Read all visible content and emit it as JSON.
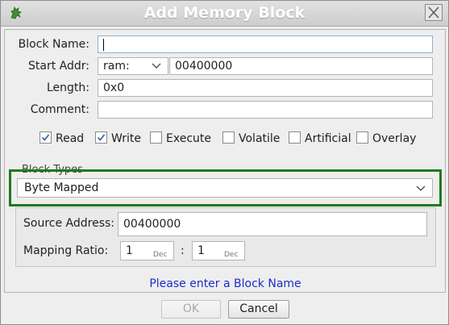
{
  "window": {
    "title": "Add Memory Block",
    "app_icon": "dragon-icon",
    "close_icon": "close-icon"
  },
  "form": {
    "block_name_label": "Block Name:",
    "block_name_value": "",
    "start_addr_label": "Start Addr:",
    "address_space": "ram:",
    "start_addr_value": "00400000",
    "length_label": "Length:",
    "length_value": "0x0",
    "comment_label": "Comment:",
    "comment_value": ""
  },
  "permissions": [
    {
      "label": "Read",
      "checked": true
    },
    {
      "label": "Write",
      "checked": true
    },
    {
      "label": "Execute",
      "checked": false
    },
    {
      "label": "Volatile",
      "checked": false
    },
    {
      "label": "Artificial",
      "checked": false
    },
    {
      "label": "Overlay",
      "checked": false
    }
  ],
  "block_types": {
    "legend": "Block Types",
    "selected": "Byte Mapped",
    "highlight_color": "#1f7a1f"
  },
  "mapping": {
    "source_address_label": "Source Address:",
    "source_address_value": "00400000",
    "mapping_ratio_label": "Mapping Ratio:",
    "ratio_left": "1",
    "ratio_left_radix": "Dec",
    "ratio_separator": ":",
    "ratio_right": "1",
    "ratio_right_radix": "Dec"
  },
  "status": {
    "message": "Please enter a Block Name",
    "color": "#1a2cc8"
  },
  "buttons": {
    "ok_label": "OK",
    "ok_enabled": false,
    "cancel_label": "Cancel"
  }
}
